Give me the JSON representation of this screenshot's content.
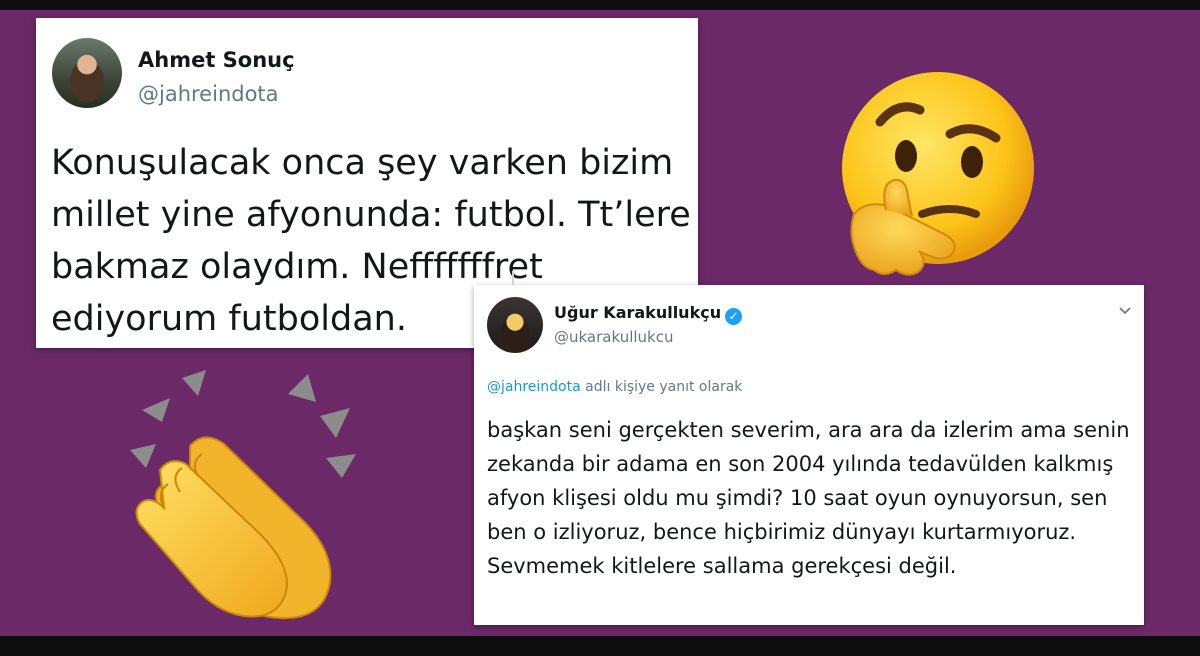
{
  "tweet1": {
    "name": "Ahmet Sonuç",
    "handle": "@jahreindota",
    "text": "Konuşulacak onca şey varken bizim millet yine afyonunda: futbol. Tt’lere bakmaz olaydım. Nefffffffret ediyorum futboldan."
  },
  "tweet2": {
    "name": "Uğur Karakullukçu",
    "handle": "@ukarakullukcu",
    "reply_mention": "@jahreindota",
    "reply_suffix": " adlı kişiye yanıt olarak",
    "text": "başkan seni gerçekten severim, ara ara da izlerim ama senin zekanda bir adama en son 2004 yılında tedavülden kalkmış afyon klişesi oldu mu şimdi? 10 saat oyun oynuyorsun, sen ben o izliyoruz, bence hiçbirimiz dünyayı kurtarmıyoruz. Sevmemek kitlelere sallama gerekçesi değil."
  },
  "icons": {
    "thinking": "thinking-face-emoji",
    "clap": "clapping-hands-emoji",
    "verified": "verified-badge-icon",
    "chevron": "chevron-down-icon"
  },
  "colors": {
    "background": "#6b2968",
    "mention": "#1b95e0",
    "verified": "#1da1f2"
  }
}
